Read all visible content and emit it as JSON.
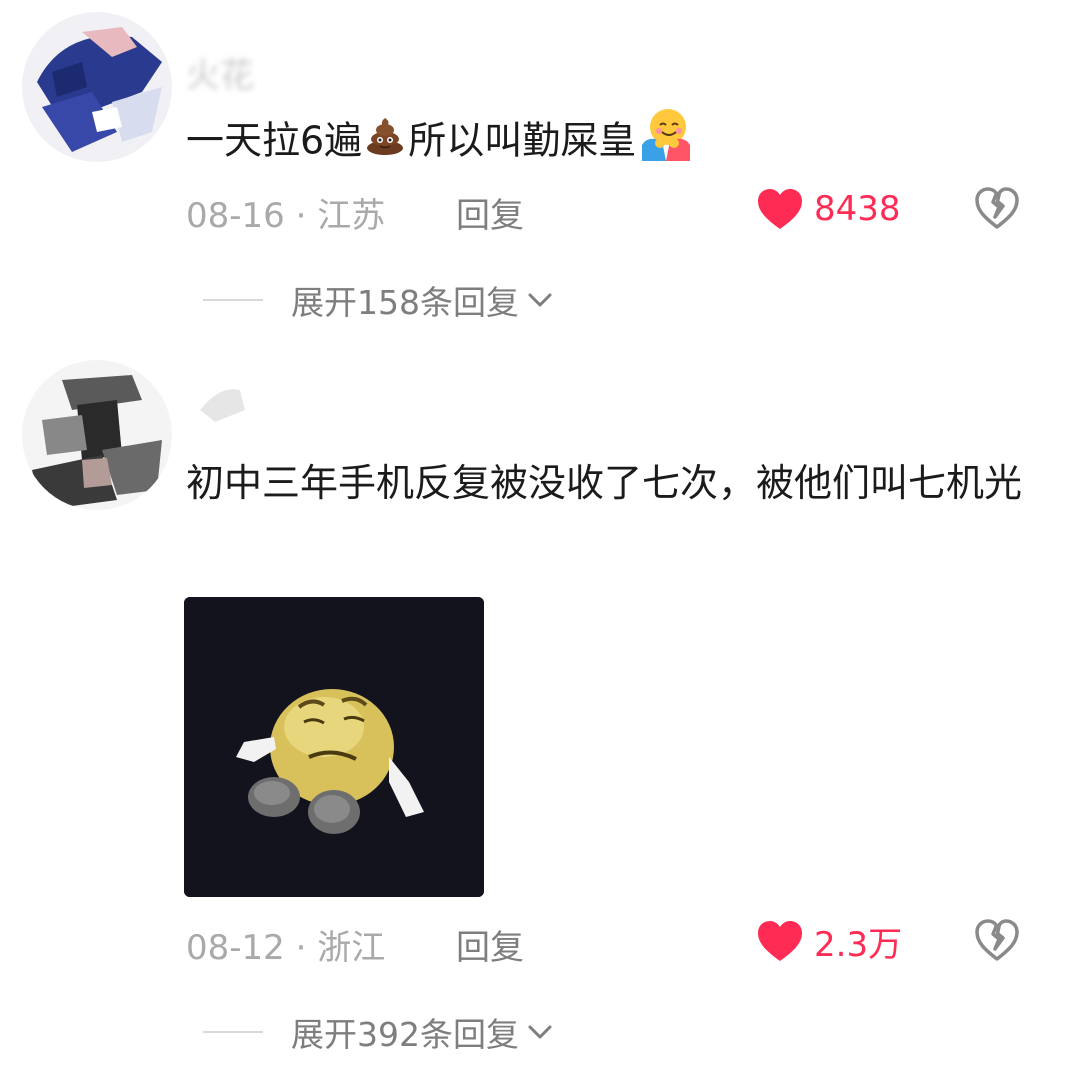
{
  "comments": [
    {
      "username": "火花",
      "text_before": "一天拉6遍",
      "text_middle": "所以叫勤屎皇",
      "emoji_1": "pile-of-poo",
      "emoji_2": "hugging-face",
      "date": "08-16",
      "location": "江苏",
      "separator": " · ",
      "reply_label": "回复",
      "likes": "8438",
      "expand_label": "展开158条回复",
      "icons": [
        "heart-icon",
        "broken-heart-icon",
        "chevron-down-icon"
      ]
    },
    {
      "username": "",
      "text": "初中三年手机反复被没收了七次，被他们叫七机光",
      "sticker": "emoji-ball-lying-down",
      "date": "08-12",
      "location": "浙江",
      "separator": " · ",
      "reply_label": "回复",
      "likes": "2.3万",
      "expand_label": "展开392条回复",
      "icons": [
        "heart-icon",
        "broken-heart-icon",
        "chevron-down-icon"
      ]
    }
  ],
  "colors": {
    "like": "#fe2c55",
    "meta": "#a9a9a9",
    "action": "#7e7e7e",
    "text": "#1b1b1b",
    "background": "#ffffff"
  }
}
